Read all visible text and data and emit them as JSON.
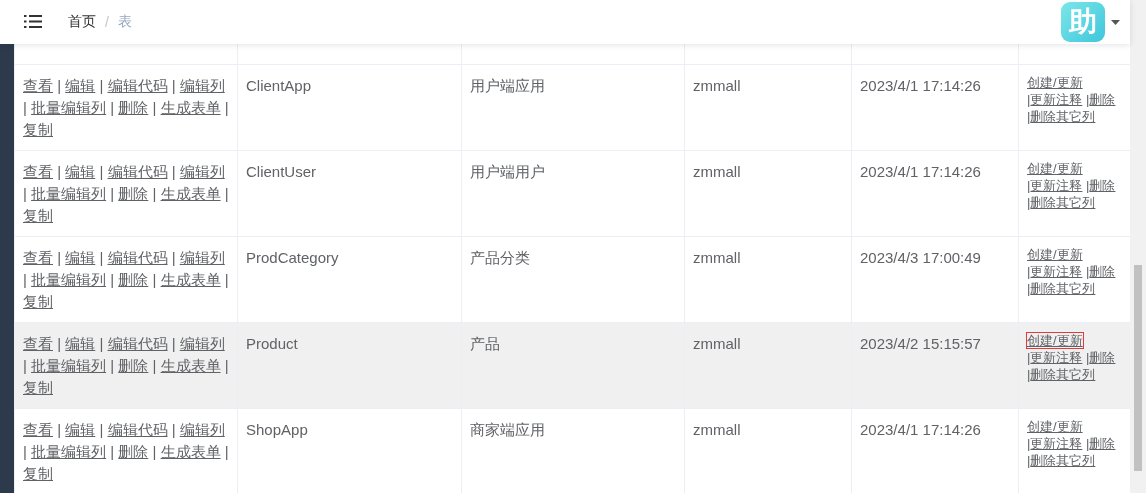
{
  "header": {
    "breadcrumb": [
      {
        "label": "首页",
        "current": false
      },
      {
        "label": "/",
        "kind": "separator"
      },
      {
        "label": "表",
        "current": true
      }
    ],
    "avatar_text": "助"
  },
  "table": {
    "rows": [
      {
        "actions": [
          {
            "kind": "link",
            "label": "查看"
          },
          {
            "kind": "separator",
            "label": "|"
          },
          {
            "kind": "link",
            "label": "编辑"
          },
          {
            "kind": "separator",
            "label": "|"
          },
          {
            "kind": "link",
            "label": "编辑代码"
          },
          {
            "kind": "separator",
            "label": "|"
          },
          {
            "kind": "link",
            "label": "编辑列"
          },
          {
            "kind": "separator",
            "label": "|"
          },
          {
            "kind": "link",
            "label": "批量编辑列"
          },
          {
            "kind": "separator",
            "label": "|"
          },
          {
            "kind": "link",
            "label": "删除"
          },
          {
            "kind": "separator",
            "label": "|"
          },
          {
            "kind": "link",
            "label": "生成表单"
          },
          {
            "kind": "separator",
            "label": "|"
          },
          {
            "kind": "link",
            "label": "复制"
          }
        ],
        "name": "ClientApp",
        "comment": "用户端应用",
        "database": "zmmall",
        "time": "2023/4/1 17:14:26",
        "hovered": false,
        "operations": [
          {
            "kind": "link",
            "label": "创建/更新",
            "focused": false
          },
          {
            "kind": "separator",
            "label": "|"
          },
          {
            "kind": "link",
            "label": "更新注释",
            "focused": false
          },
          {
            "kind": "separator",
            "label": "|"
          },
          {
            "kind": "link",
            "label": "删除",
            "focused": false
          },
          {
            "kind": "separator",
            "label": "|"
          },
          {
            "kind": "link",
            "label": "删除其它列",
            "focused": false
          }
        ]
      },
      {
        "actions": [
          {
            "kind": "link",
            "label": "查看"
          },
          {
            "kind": "separator",
            "label": "|"
          },
          {
            "kind": "link",
            "label": "编辑"
          },
          {
            "kind": "separator",
            "label": "|"
          },
          {
            "kind": "link",
            "label": "编辑代码"
          },
          {
            "kind": "separator",
            "label": "|"
          },
          {
            "kind": "link",
            "label": "编辑列"
          },
          {
            "kind": "separator",
            "label": "|"
          },
          {
            "kind": "link",
            "label": "批量编辑列"
          },
          {
            "kind": "separator",
            "label": "|"
          },
          {
            "kind": "link",
            "label": "删除"
          },
          {
            "kind": "separator",
            "label": "|"
          },
          {
            "kind": "link",
            "label": "生成表单"
          },
          {
            "kind": "separator",
            "label": "|"
          },
          {
            "kind": "link",
            "label": "复制"
          }
        ],
        "name": "ClientUser",
        "comment": "用户端用户",
        "database": "zmmall",
        "time": "2023/4/1 17:14:26",
        "hovered": false,
        "operations": [
          {
            "kind": "link",
            "label": "创建/更新",
            "focused": false
          },
          {
            "kind": "separator",
            "label": "|"
          },
          {
            "kind": "link",
            "label": "更新注释",
            "focused": false
          },
          {
            "kind": "separator",
            "label": "|"
          },
          {
            "kind": "link",
            "label": "删除",
            "focused": false
          },
          {
            "kind": "separator",
            "label": "|"
          },
          {
            "kind": "link",
            "label": "删除其它列",
            "focused": false
          }
        ]
      },
      {
        "actions": [
          {
            "kind": "link",
            "label": "查看"
          },
          {
            "kind": "separator",
            "label": "|"
          },
          {
            "kind": "link",
            "label": "编辑"
          },
          {
            "kind": "separator",
            "label": "|"
          },
          {
            "kind": "link",
            "label": "编辑代码"
          },
          {
            "kind": "separator",
            "label": "|"
          },
          {
            "kind": "link",
            "label": "编辑列"
          },
          {
            "kind": "separator",
            "label": "|"
          },
          {
            "kind": "link",
            "label": "批量编辑列"
          },
          {
            "kind": "separator",
            "label": "|"
          },
          {
            "kind": "link",
            "label": "删除"
          },
          {
            "kind": "separator",
            "label": "|"
          },
          {
            "kind": "link",
            "label": "生成表单"
          },
          {
            "kind": "separator",
            "label": "|"
          },
          {
            "kind": "link",
            "label": "复制"
          }
        ],
        "name": "ProdCategory",
        "comment": "产品分类",
        "database": "zmmall",
        "time": "2023/4/3 17:00:49",
        "hovered": false,
        "operations": [
          {
            "kind": "link",
            "label": "创建/更新",
            "focused": false
          },
          {
            "kind": "separator",
            "label": "|"
          },
          {
            "kind": "link",
            "label": "更新注释",
            "focused": false
          },
          {
            "kind": "separator",
            "label": "|"
          },
          {
            "kind": "link",
            "label": "删除",
            "focused": false
          },
          {
            "kind": "separator",
            "label": "|"
          },
          {
            "kind": "link",
            "label": "删除其它列",
            "focused": false
          }
        ]
      },
      {
        "actions": [
          {
            "kind": "link",
            "label": "查看"
          },
          {
            "kind": "separator",
            "label": "|"
          },
          {
            "kind": "link",
            "label": "编辑"
          },
          {
            "kind": "separator",
            "label": "|"
          },
          {
            "kind": "link",
            "label": "编辑代码"
          },
          {
            "kind": "separator",
            "label": "|"
          },
          {
            "kind": "link",
            "label": "编辑列"
          },
          {
            "kind": "separator",
            "label": "|"
          },
          {
            "kind": "link",
            "label": "批量编辑列"
          },
          {
            "kind": "separator",
            "label": "|"
          },
          {
            "kind": "link",
            "label": "删除"
          },
          {
            "kind": "separator",
            "label": "|"
          },
          {
            "kind": "link",
            "label": "生成表单"
          },
          {
            "kind": "separator",
            "label": "|"
          },
          {
            "kind": "link",
            "label": "复制"
          }
        ],
        "name": "Product",
        "comment": "产品",
        "database": "zmmall",
        "time": "2023/4/2 15:15:57",
        "hovered": true,
        "operations": [
          {
            "kind": "link",
            "label": "创建/更新",
            "focused": true
          },
          {
            "kind": "separator",
            "label": "|"
          },
          {
            "kind": "link",
            "label": "更新注释",
            "focused": false
          },
          {
            "kind": "separator",
            "label": "|"
          },
          {
            "kind": "link",
            "label": "删除",
            "focused": false
          },
          {
            "kind": "separator",
            "label": "|"
          },
          {
            "kind": "link",
            "label": "删除其它列",
            "focused": false
          }
        ]
      },
      {
        "actions": [
          {
            "kind": "link",
            "label": "查看"
          },
          {
            "kind": "separator",
            "label": "|"
          },
          {
            "kind": "link",
            "label": "编辑"
          },
          {
            "kind": "separator",
            "label": "|"
          },
          {
            "kind": "link",
            "label": "编辑代码"
          },
          {
            "kind": "separator",
            "label": "|"
          },
          {
            "kind": "link",
            "label": "编辑列"
          },
          {
            "kind": "separator",
            "label": "|"
          },
          {
            "kind": "link",
            "label": "批量编辑列"
          },
          {
            "kind": "separator",
            "label": "|"
          },
          {
            "kind": "link",
            "label": "删除"
          },
          {
            "kind": "separator",
            "label": "|"
          },
          {
            "kind": "link",
            "label": "生成表单"
          },
          {
            "kind": "separator",
            "label": "|"
          },
          {
            "kind": "link",
            "label": "复制"
          }
        ],
        "name": "ShopApp",
        "comment": "商家端应用",
        "database": "zmmall",
        "time": "2023/4/1 17:14:26",
        "hovered": false,
        "operations": [
          {
            "kind": "link",
            "label": "创建/更新",
            "focused": false
          },
          {
            "kind": "separator",
            "label": "|"
          },
          {
            "kind": "link",
            "label": "更新注释",
            "focused": false
          },
          {
            "kind": "separator",
            "label": "|"
          },
          {
            "kind": "link",
            "label": "删除",
            "focused": false
          },
          {
            "kind": "separator",
            "label": "|"
          },
          {
            "kind": "link",
            "label": "删除其它列",
            "focused": false
          }
        ]
      }
    ]
  }
}
